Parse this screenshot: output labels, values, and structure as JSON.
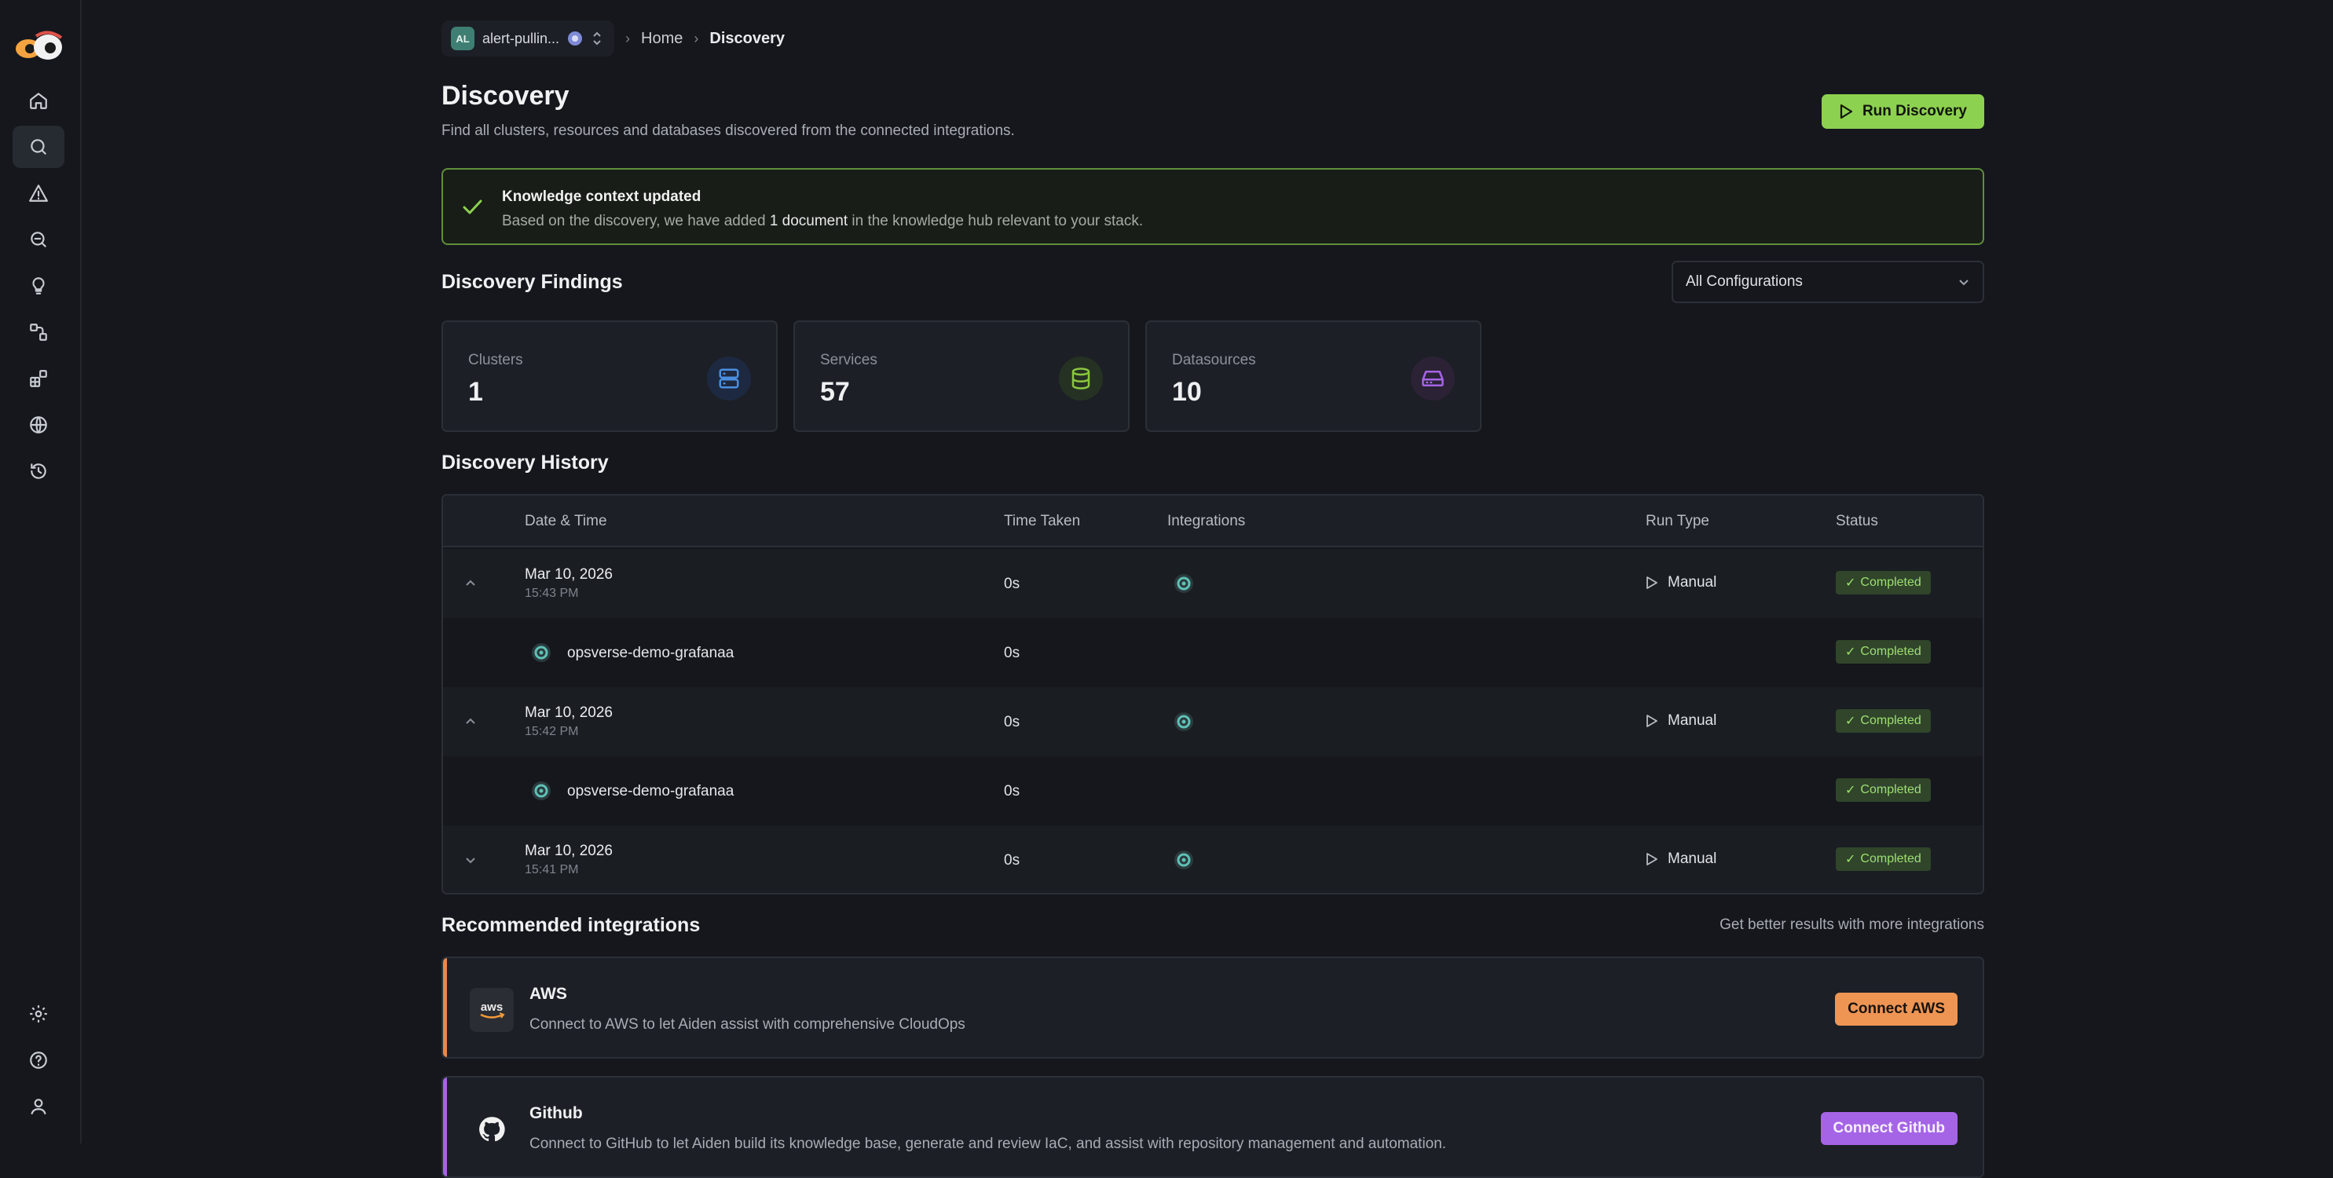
{
  "header": {
    "org_badge": "AL",
    "org_name": "alert-pullin...",
    "breadcrumbs": [
      "Home",
      "Discovery"
    ]
  },
  "page": {
    "title": "Discovery",
    "subtitle": "Find all clusters, resources and databases discovered from the connected integrations.",
    "run_button": "Run Discovery"
  },
  "notice": {
    "title": "Knowledge context updated",
    "text_before": "Based on the discovery, we have added ",
    "text_highlight": "1 document",
    "text_after": " in the knowledge hub relevant to your stack."
  },
  "findings": {
    "title": "Discovery Findings",
    "filter_value": "All Configurations",
    "stats": [
      {
        "label": "Clusters",
        "value": "1",
        "icon": "server-icon",
        "color": "#4a8fe0"
      },
      {
        "label": "Services",
        "value": "57",
        "icon": "database-icon",
        "color": "#8cc63f"
      },
      {
        "label": "Datasources",
        "value": "10",
        "icon": "hard-drive-icon",
        "color": "#a564e6"
      }
    ]
  },
  "history": {
    "title": "Discovery History",
    "columns": [
      "Date & Time",
      "Time Taken",
      "Integrations",
      "Run Type",
      "Status"
    ],
    "rows": [
      {
        "date": "Mar 10, 2026",
        "time": "15:43 PM",
        "taken": "0s",
        "run_type": "Manual",
        "status": "Completed",
        "expanded": true,
        "children": [
          {
            "name": "opsverse-demo-grafanaa",
            "taken": "0s",
            "status": "Completed"
          }
        ]
      },
      {
        "date": "Mar 10, 2026",
        "time": "15:42 PM",
        "taken": "0s",
        "run_type": "Manual",
        "status": "Completed",
        "expanded": true,
        "children": [
          {
            "name": "opsverse-demo-grafanaa",
            "taken": "0s",
            "status": "Completed"
          }
        ]
      },
      {
        "date": "Mar 10, 2026",
        "time": "15:41 PM",
        "taken": "0s",
        "run_type": "Manual",
        "status": "Completed",
        "expanded": false
      }
    ]
  },
  "recommended": {
    "title": "Recommended integrations",
    "note": "Get better results with more integrations",
    "items": [
      {
        "name": "AWS",
        "logo_text": "aws",
        "description": "Connect to AWS to let Aiden assist with comprehensive CloudOps",
        "button": "Connect AWS",
        "accent": "#e8894a"
      },
      {
        "name": "Github",
        "description": "Connect to GitHub to let Aiden build its knowledge base, generate and review IaC, and assist with repository management and automation.",
        "button": "Connect Github",
        "accent": "#a564e6"
      }
    ]
  },
  "sidebar": {
    "items": [
      "home-icon",
      "search-icon",
      "alert-triangle-icon",
      "zoom-icon",
      "lightbulb-icon",
      "workflow-icon",
      "integrations-icon",
      "globe-icon",
      "history-icon",
      "settings-icon",
      "help-icon",
      "user-icon"
    ]
  }
}
